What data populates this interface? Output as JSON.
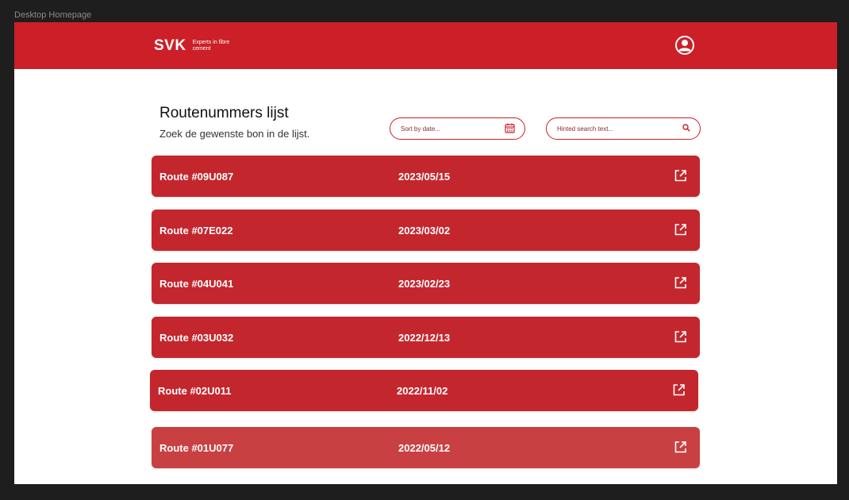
{
  "frame_label": "Desktop Homepage",
  "brand": {
    "logo": "SVK",
    "tagline": "Experts in fibre cement",
    "color": "#cc1f27"
  },
  "header": {
    "account_icon": "user-circle-icon"
  },
  "page": {
    "title": "Routenummers lijst",
    "subtitle": "Zoek de gewenste bon in de lijst."
  },
  "filters": {
    "sort_label": "Sort by date...",
    "sort_icon": "calendar-icon",
    "search_placeholder": "Hinted search text...",
    "search_icon": "search-icon"
  },
  "routes": [
    {
      "name": "Route #09U087",
      "date": "2023/05/15"
    },
    {
      "name": "Route #07E022",
      "date": "2023/03/02"
    },
    {
      "name": "Route #04U041",
      "date": "2023/02/23"
    },
    {
      "name": "Route #03U032",
      "date": "2022/12/13"
    },
    {
      "name": "Route #02U011",
      "date": "2022/11/02"
    },
    {
      "name": "Route #01U077",
      "date": "2022/05/12"
    }
  ]
}
